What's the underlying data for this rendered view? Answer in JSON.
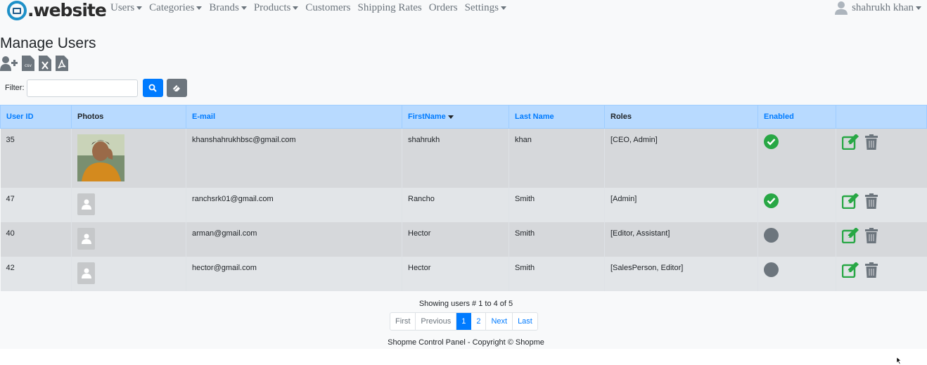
{
  "brand": {
    "logo_text": ".website"
  },
  "nav": {
    "items": [
      {
        "label": "Users",
        "dropdown": true
      },
      {
        "label": "Categories",
        "dropdown": true
      },
      {
        "label": "Brands",
        "dropdown": true
      },
      {
        "label": "Products",
        "dropdown": true
      },
      {
        "label": "Customers",
        "dropdown": false
      },
      {
        "label": "Shipping Rates",
        "dropdown": false
      },
      {
        "label": "Orders",
        "dropdown": false
      },
      {
        "label": "Settings",
        "dropdown": true
      }
    ],
    "user_name": "shahrukh khan"
  },
  "page": {
    "title": "Manage Users"
  },
  "toolbar": {
    "icons": [
      "add-user-icon",
      "csv-export-icon",
      "excel-export-icon",
      "pdf-export-icon"
    ]
  },
  "filter": {
    "label": "Filter:",
    "value": "",
    "placeholder": ""
  },
  "table": {
    "headers": [
      "User ID",
      "Photos",
      "E-mail",
      "FirstName",
      "Last Name",
      "Roles",
      "Enabled",
      ""
    ],
    "rows": [
      {
        "id": "35",
        "photo": "user-photo",
        "email": "khanshahrukhbsc@gmail.com",
        "first": "shahrukh",
        "last": "khan",
        "roles": "[CEO, Admin]",
        "enabled": true
      },
      {
        "id": "47",
        "photo": "default-avatar",
        "email": "ranchsrk01@gmail.com",
        "first": "Rancho",
        "last": "Smith",
        "roles": "[Admin]",
        "enabled": true
      },
      {
        "id": "40",
        "photo": "default-avatar",
        "email": "arman@gmail.com",
        "first": "Hector",
        "last": "Smith",
        "roles": "[Editor, Assistant]",
        "enabled": false
      },
      {
        "id": "42",
        "photo": "default-avatar",
        "email": "hector@gmail.com",
        "first": "Hector",
        "last": "Smith",
        "roles": "[SalesPerson, Editor]",
        "enabled": false
      }
    ]
  },
  "pagination": {
    "info": "Showing users # 1 to 4 of 5",
    "first": "First",
    "previous": "Previous",
    "pages": [
      "1",
      "2"
    ],
    "current": "1",
    "next": "Next",
    "last": "Last"
  },
  "footer": {
    "text": "Shopme Control Panel - Copyright © Shopme"
  },
  "colors": {
    "primary": "#007bff",
    "header_bg": "#b8daff",
    "enabled_green": "#28a745",
    "disabled_gray": "#6c757d"
  }
}
